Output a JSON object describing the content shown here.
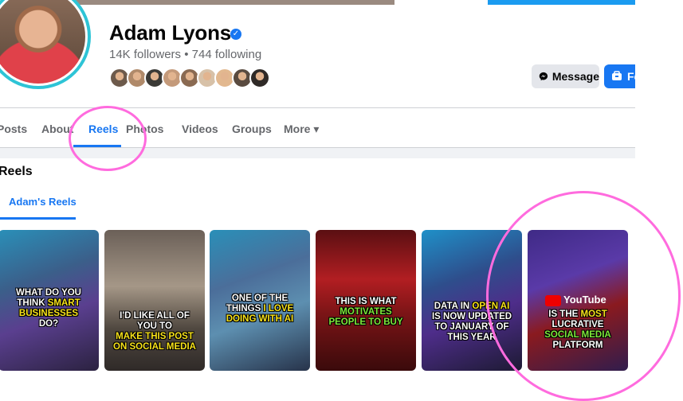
{
  "profile": {
    "name": "Adam Lyons",
    "stats": "14K followers • 744 following",
    "verified_icon": "verified-badge-icon",
    "mutual_friend_colors": [
      "#6d5a4b",
      "#b08a6a",
      "#3b3a36",
      "#c49a7a",
      "#8a6a52",
      "#d7c1a8",
      "#e2b88f",
      "#5a4b40",
      "#2f2a27"
    ]
  },
  "actions": {
    "message_label": "Message",
    "follow_label": "Fo"
  },
  "tabs": [
    {
      "label": "Posts"
    },
    {
      "label": "About"
    },
    {
      "label": "Reels"
    },
    {
      "label": "Photos"
    },
    {
      "label": "Videos"
    },
    {
      "label": "Groups"
    },
    {
      "label": "More ▾"
    }
  ],
  "reels_section": {
    "title": "Reels",
    "subtab": "Adam's Reels",
    "reels": [
      {
        "lines": [
          [
            "WHAT DO YOU",
            ""
          ],
          [
            "THINK ",
            "SMART"
          ],
          [
            "BUSINESSES",
            "hl"
          ],
          [
            "DO?",
            ""
          ]
        ]
      },
      {
        "lines": [
          [
            "I'D LIKE ALL OF",
            ""
          ],
          [
            "YOU TO",
            ""
          ],
          [
            "MAKE THIS POST",
            "hl"
          ],
          [
            "ON SOCIAL MEDIA",
            "hl"
          ]
        ]
      },
      {
        "lines": [
          [
            "ONE OF THE",
            ""
          ],
          [
            "THINGS ",
            "I LOVE"
          ],
          [
            "DOING WITH AI",
            "hl"
          ]
        ]
      },
      {
        "lines": [
          [
            "THIS IS WHAT",
            ""
          ],
          [
            "MOTIVATES",
            "hlg"
          ],
          [
            "PEOPLE TO BUY",
            "hlg"
          ]
        ]
      },
      {
        "lines": [
          [
            "DATA IN ",
            "OPEN AI"
          ],
          [
            "IS NOW UPDATED",
            ""
          ],
          [
            "TO JANUARY OF",
            ""
          ],
          [
            "THIS YEAR",
            ""
          ]
        ]
      },
      {
        "lines": [
          [
            "IS THE ",
            "MOST"
          ],
          [
            "LUCRATIVE",
            ""
          ],
          [
            "SOCIAL MEDIA",
            "hlg"
          ],
          [
            "PLATFORM",
            ""
          ]
        ],
        "logo": "YouTube"
      }
    ]
  },
  "colors": {
    "accent": "#1877f2",
    "annotation": "#ff6bde"
  }
}
